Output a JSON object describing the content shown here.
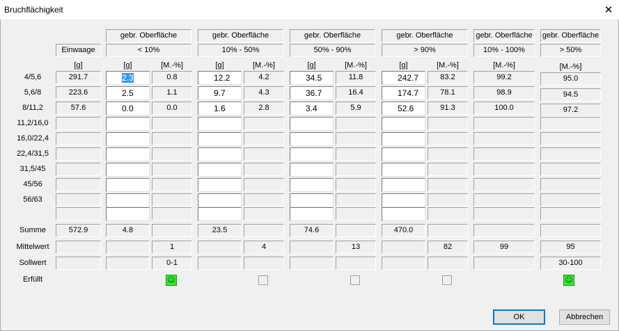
{
  "window": {
    "title": "Bruchflächigkeit",
    "close_glyph": "✕"
  },
  "top_headers": [
    "gebr. Oberfläche",
    "gebr. Oberfläche",
    "gebr. Oberfläche",
    "gebr. Oberfläche",
    "gebr. Oberfläche",
    "gebr. Oberfläche"
  ],
  "einwaage_label": "Einwaage",
  "ranges": [
    "< 10%",
    "10% - 50%",
    "50% - 90%",
    "> 90%",
    "10% - 100%",
    "> 50%"
  ],
  "units": {
    "g": "[g]",
    "pct": "[M.-%]"
  },
  "row_labels": [
    "4/5,6",
    "5,6/8",
    "8/11,2",
    "11,2/16,0",
    "16,0/22,4",
    "22,4/31,5",
    "31,5/45",
    "45/56",
    "56/63",
    ""
  ],
  "rows": [
    {
      "einwaage": "291.7",
      "g": [
        "2.3",
        "12.2",
        "34.5",
        "242.7"
      ],
      "pct": [
        "0.8",
        "4.2",
        "11.8",
        "83.2"
      ],
      "p10_100": "99.2",
      "p50": "95.0"
    },
    {
      "einwaage": "223.6",
      "g": [
        "2.5",
        "9.7",
        "36.7",
        "174.7"
      ],
      "pct": [
        "1.1",
        "4.3",
        "16.4",
        "78.1"
      ],
      "p10_100": "98.9",
      "p50": "94.5"
    },
    {
      "einwaage": "57.6",
      "g": [
        "0.0",
        "1.6",
        "3.4",
        "52.6"
      ],
      "pct": [
        "0.0",
        "2.8",
        "5.9",
        "91.3"
      ],
      "p10_100": "100.0",
      "p50": "97.2"
    },
    {
      "einwaage": "",
      "g": [
        "",
        "",
        "",
        ""
      ],
      "pct": [
        "",
        "",
        "",
        ""
      ],
      "p10_100": "",
      "p50": ""
    },
    {
      "einwaage": "",
      "g": [
        "",
        "",
        "",
        ""
      ],
      "pct": [
        "",
        "",
        "",
        ""
      ],
      "p10_100": "",
      "p50": ""
    },
    {
      "einwaage": "",
      "g": [
        "",
        "",
        "",
        ""
      ],
      "pct": [
        "",
        "",
        "",
        ""
      ],
      "p10_100": "",
      "p50": ""
    },
    {
      "einwaage": "",
      "g": [
        "",
        "",
        "",
        ""
      ],
      "pct": [
        "",
        "",
        "",
        ""
      ],
      "p10_100": "",
      "p50": ""
    },
    {
      "einwaage": "",
      "g": [
        "",
        "",
        "",
        ""
      ],
      "pct": [
        "",
        "",
        "",
        ""
      ],
      "p10_100": "",
      "p50": ""
    },
    {
      "einwaage": "",
      "g": [
        "",
        "",
        "",
        ""
      ],
      "pct": [
        "",
        "",
        "",
        ""
      ],
      "p10_100": "",
      "p50": ""
    },
    {
      "einwaage": "",
      "g": [
        "",
        "",
        "",
        ""
      ],
      "pct": [
        "",
        "",
        "",
        ""
      ],
      "p10_100": "",
      "p50": ""
    }
  ],
  "summary": {
    "summe_label": "Summe",
    "summe": {
      "einwaage": "572.9",
      "g": [
        "4.8",
        "23.5",
        "74.6",
        "470.0"
      ]
    },
    "mittelwert_label": "Mittelwert",
    "mittelwert": {
      "pct": [
        "1",
        "4",
        "13",
        "82"
      ],
      "p10_100": "99",
      "p50": "95"
    },
    "sollwert_label": "Sollwert",
    "sollwert": {
      "pct": [
        "0-1",
        "",
        "",
        ""
      ],
      "p10_100": "",
      "p50": "30-100"
    },
    "erfuellt_label": "Erfüllt",
    "erfuellt": [
      true,
      false,
      false,
      false,
      true
    ],
    "smile_glyph": "☺",
    "ok_color": "#33e633"
  },
  "buttons": {
    "ok": "OK",
    "cancel": "Abbrechen"
  }
}
